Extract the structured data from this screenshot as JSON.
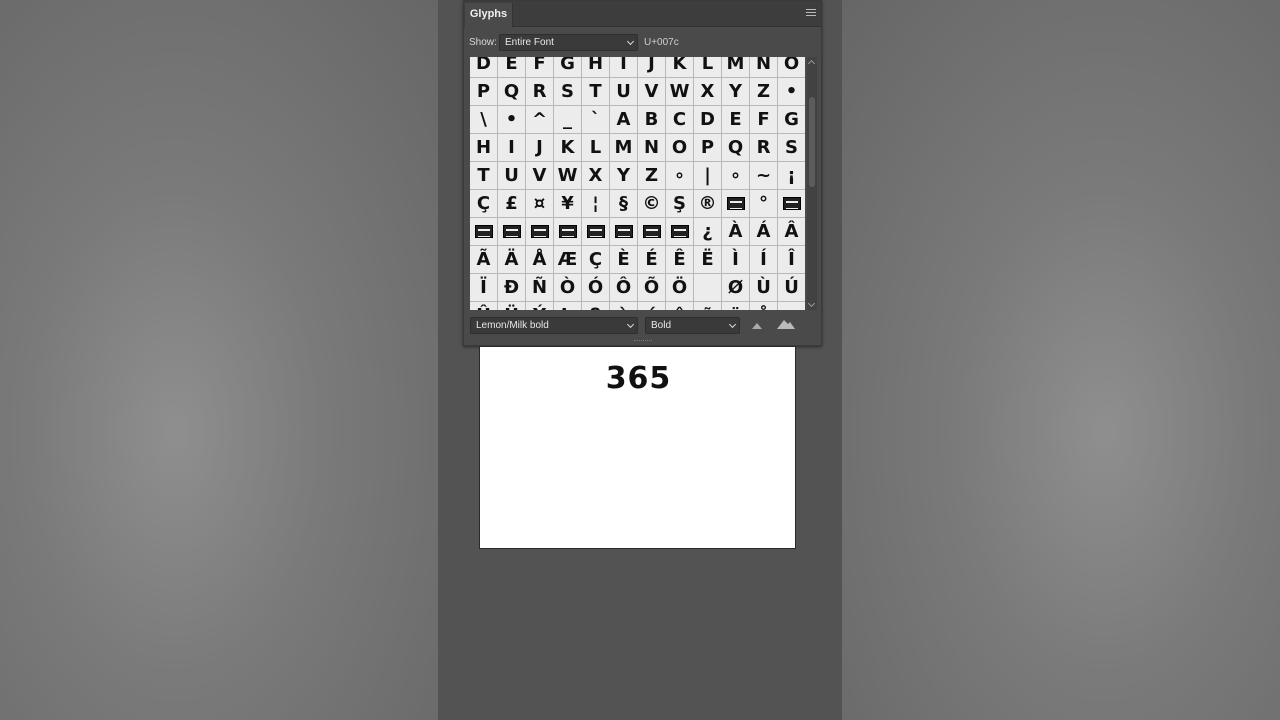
{
  "panel": {
    "tab_title": "Glyphs",
    "show_label": "Show:",
    "show_value": "Entire Font",
    "unicode_value": "U+007c",
    "font_family": "Lemon/Milk bold",
    "font_style": "Bold"
  },
  "glyph_rows": [
    [
      "D",
      "E",
      "F",
      "G",
      "H",
      "I",
      "J",
      "K",
      "L",
      "M",
      "N",
      "O"
    ],
    [
      "P",
      "Q",
      "R",
      "S",
      "T",
      "U",
      "V",
      "W",
      "X",
      "Y",
      "Z",
      "•"
    ],
    [
      "\\",
      "•",
      "^",
      "_",
      "`",
      "A",
      "B",
      "C",
      "D",
      "E",
      "F",
      "G"
    ],
    [
      "H",
      "I",
      "J",
      "K",
      "L",
      "M",
      "N",
      "O",
      "P",
      "Q",
      "R",
      "S"
    ],
    [
      "T",
      "U",
      "V",
      "W",
      "X",
      "Y",
      "Z",
      "∘",
      "|",
      "∘",
      "~",
      "¡"
    ],
    [
      "Ç",
      "£",
      "¤",
      "¥",
      "¦",
      "§",
      "©",
      "Ş",
      "®",
      "[box]",
      "°",
      "[box]"
    ],
    [
      "[box]",
      "[box]",
      "[box]",
      "[box]",
      "[box]",
      "[box]",
      "[box]",
      "[box]",
      "¿",
      "À",
      "Á",
      "Â"
    ],
    [
      "Ã",
      "Ä",
      "Å",
      "Æ",
      "Ç",
      "È",
      "É",
      "Ê",
      "Ë",
      "Ì",
      "Í",
      "Î"
    ],
    [
      "Ï",
      "Ð",
      "Ñ",
      "Ò",
      "Ó",
      "Ô",
      "Õ",
      "Ö",
      "",
      "Ø",
      "Ù",
      "Ú"
    ],
    [
      "Û",
      "Ü",
      "Ý",
      "Þ",
      "ß",
      "à",
      "á",
      "â",
      "ã",
      "ä",
      "å",
      "æ"
    ]
  ],
  "document": {
    "text": "365"
  },
  "colors": {
    "workspace": "#535353",
    "panel": "#4a4a4a",
    "glyph_cell": "#ececec"
  }
}
